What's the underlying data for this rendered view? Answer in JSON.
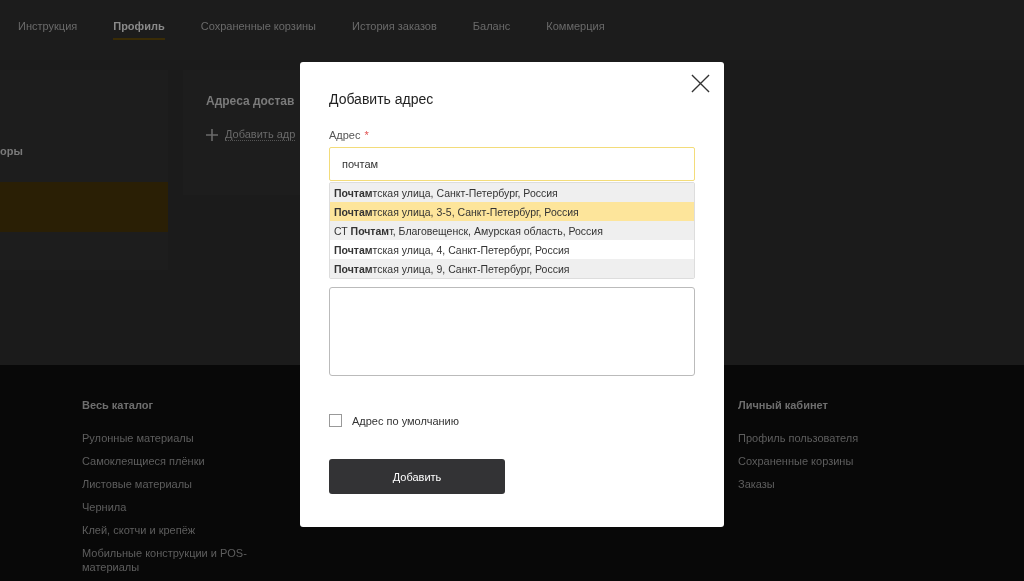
{
  "nav_tabs": [
    {
      "label": "Инструкция",
      "selected": false
    },
    {
      "label": "Профиль",
      "selected": true
    },
    {
      "label": "Сохраненные корзины",
      "selected": false
    },
    {
      "label": "История заказов",
      "selected": false
    },
    {
      "label": "Баланс",
      "selected": false
    },
    {
      "label": "Коммерция",
      "selected": false
    }
  ],
  "sidebar": {
    "item_label": "оры"
  },
  "addresses_card": {
    "title": "Адреса достав",
    "add_link": "Добавить адр"
  },
  "modal": {
    "title": "Добавить адрес",
    "address_field": {
      "label": "Адрес",
      "required_mark": "*",
      "value": "почтам"
    },
    "suggestions": [
      {
        "text": "**Почтам**тская улица, Санкт-Петербург, Россия",
        "selected": false
      },
      {
        "text": "**Почтам**тская улица, 3-5, Санкт-Петербург, Россия",
        "selected": true
      },
      {
        "text": "СТ **Почтам**т, Благовещенск, Амурская область, Россия",
        "selected": false
      },
      {
        "text": "**Почтам**тская улица, 4, Санкт-Петербург, Россия",
        "selected": false
      },
      {
        "text": "**Почтам**тская улица, 9, Санкт-Петербург, Россия",
        "selected": false
      }
    ],
    "default_checkbox": {
      "label": "Адрес по умолчанию",
      "checked": false
    },
    "submit_button": "Добавить"
  },
  "footer": {
    "columns": [
      {
        "title": "Весь каталог",
        "links": [
          "Рулонные материалы",
          "Самоклеящиеся плёнки",
          "Листовые материалы",
          "Чернила",
          "Клей, скотчи и крепёж",
          "Мобильные конструкции и POS-материалы"
        ]
      },
      {
        "title": "Личный кабинет",
        "links": [
          "Профиль пользователя",
          "Сохраненные корзины",
          "Заказы"
        ]
      }
    ]
  }
}
